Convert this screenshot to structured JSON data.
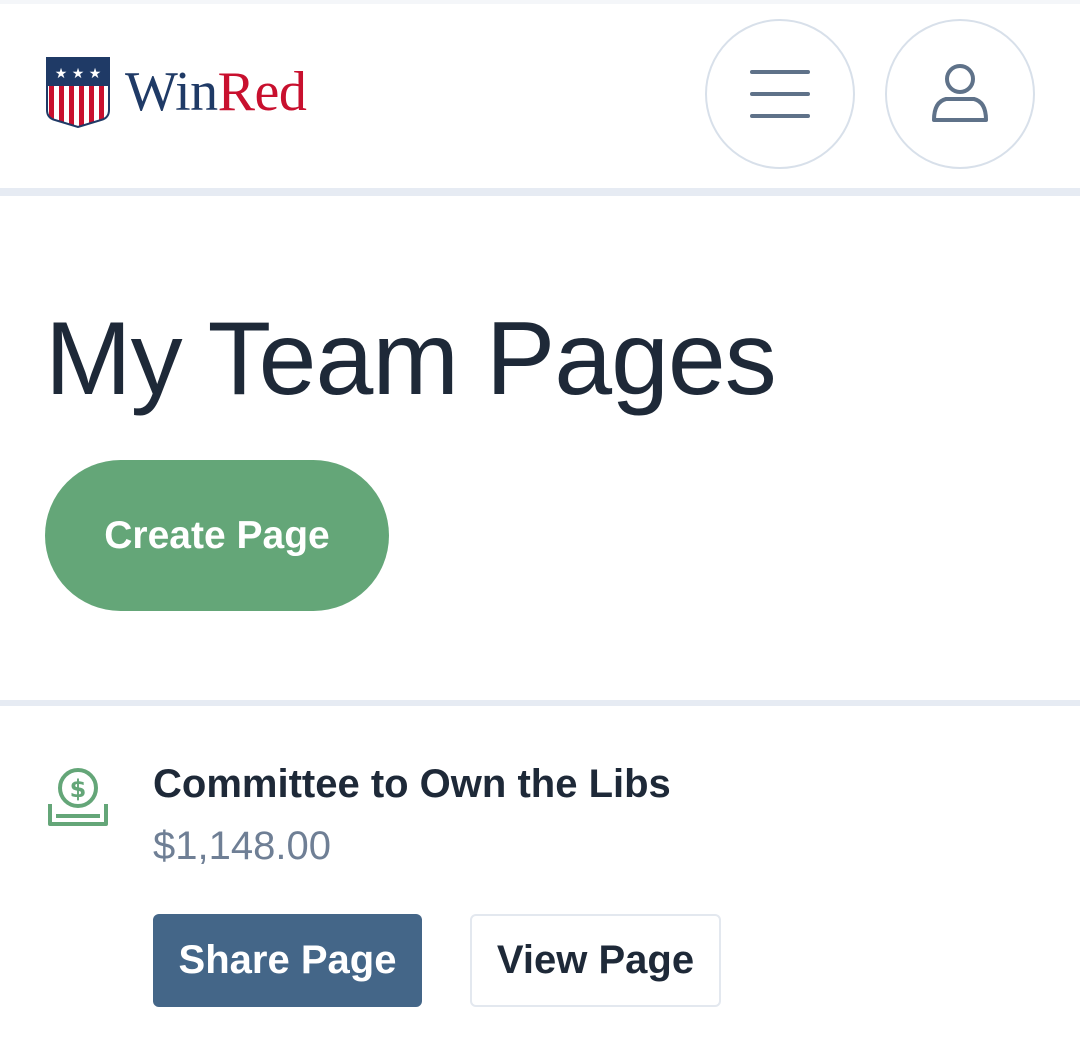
{
  "brand": {
    "name_part1": "Win",
    "name_part2": "Red",
    "primary_color": "#1f3a66",
    "accent_color": "#c8102e"
  },
  "header": {
    "menu_icon": "hamburger-icon",
    "user_icon": "user-icon"
  },
  "main": {
    "title": "My Team Pages",
    "create_button_label": "Create Page",
    "create_button_color": "#64a678"
  },
  "pages": [
    {
      "icon": "donation-money-icon",
      "name": "Committee to Own the Libs",
      "amount": "$1,148.00",
      "share_label": "Share Page",
      "view_label": "View Page"
    }
  ]
}
